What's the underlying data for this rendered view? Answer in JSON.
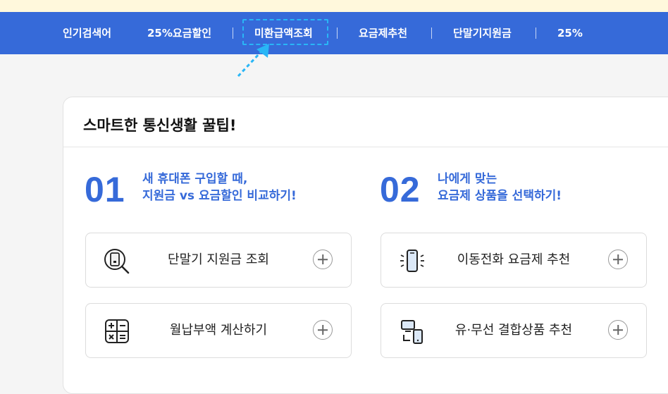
{
  "nav": {
    "label": "인기검색어",
    "items": [
      "25%요금할인",
      "미환급액조회",
      "요금제추천",
      "단말기지원금",
      "25%"
    ],
    "highlighted_item": "미환급액조회"
  },
  "card": {
    "title": "스마트한 통신생활 꿀팁!",
    "sections": [
      {
        "number": "01",
        "line1": "새 휴대폰 구입할 때,",
        "line2": "지원금 vs 요금할인 비교하기!",
        "tiles": [
          {
            "label": "단말기 지원금 조회",
            "icon": "phone-search-icon"
          },
          {
            "label": "월납부액 계산하기",
            "icon": "calculator-icon"
          }
        ]
      },
      {
        "number": "02",
        "line1": "나에게 맞는",
        "line2": "요금제 상품을 선택하기!",
        "tiles": [
          {
            "label": "이동전화 요금제 추천",
            "icon": "phone-ringing-icon"
          },
          {
            "label": "유·무선 결합상품 추천",
            "icon": "devices-icon"
          }
        ]
      }
    ]
  },
  "colors": {
    "nav_bg": "#366ad9",
    "accent": "#366ad9",
    "highlight": "#29b6f6",
    "top_band": "#fff8dc"
  }
}
